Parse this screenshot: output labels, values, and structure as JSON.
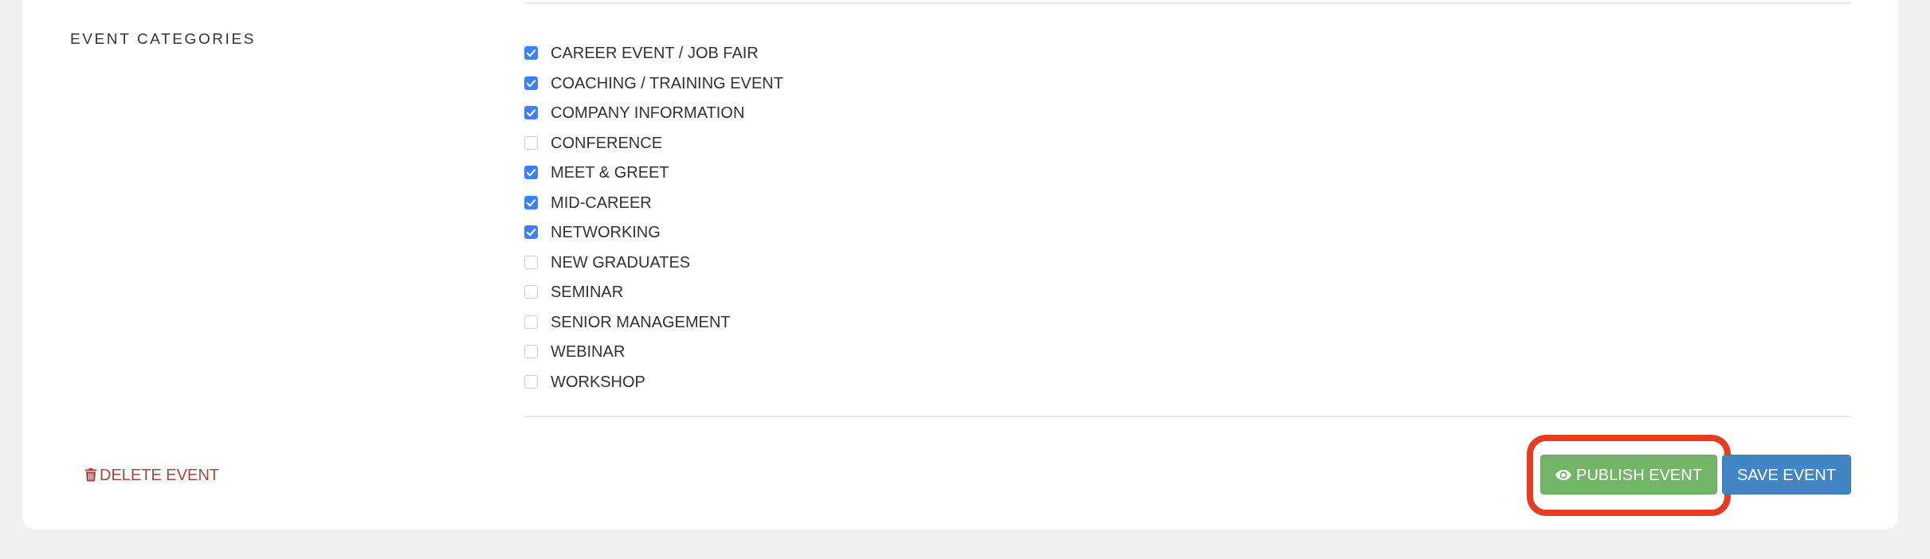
{
  "section": {
    "label": "EVENT CATEGORIES"
  },
  "categories": [
    {
      "label": "CAREER EVENT / JOB FAIR",
      "checked": true
    },
    {
      "label": "COACHING / TRAINING EVENT",
      "checked": true
    },
    {
      "label": "COMPANY INFORMATION",
      "checked": true
    },
    {
      "label": "CONFERENCE",
      "checked": false
    },
    {
      "label": "MEET & GREET",
      "checked": true
    },
    {
      "label": "MID-CAREER",
      "checked": true
    },
    {
      "label": "NETWORKING",
      "checked": true
    },
    {
      "label": "NEW GRADUATES",
      "checked": false
    },
    {
      "label": "SEMINAR",
      "checked": false
    },
    {
      "label": "SENIOR MANAGEMENT",
      "checked": false
    },
    {
      "label": "WEBINAR",
      "checked": false
    },
    {
      "label": "WORKSHOP",
      "checked": false
    }
  ],
  "delete_link": {
    "label": "DELETE EVENT"
  },
  "buttons": [
    {
      "kind": "publish",
      "label": "PUBLISH EVENT",
      "highlighted": true
    },
    {
      "kind": "save",
      "label": "SAVE EVENT",
      "highlighted": false
    }
  ]
}
